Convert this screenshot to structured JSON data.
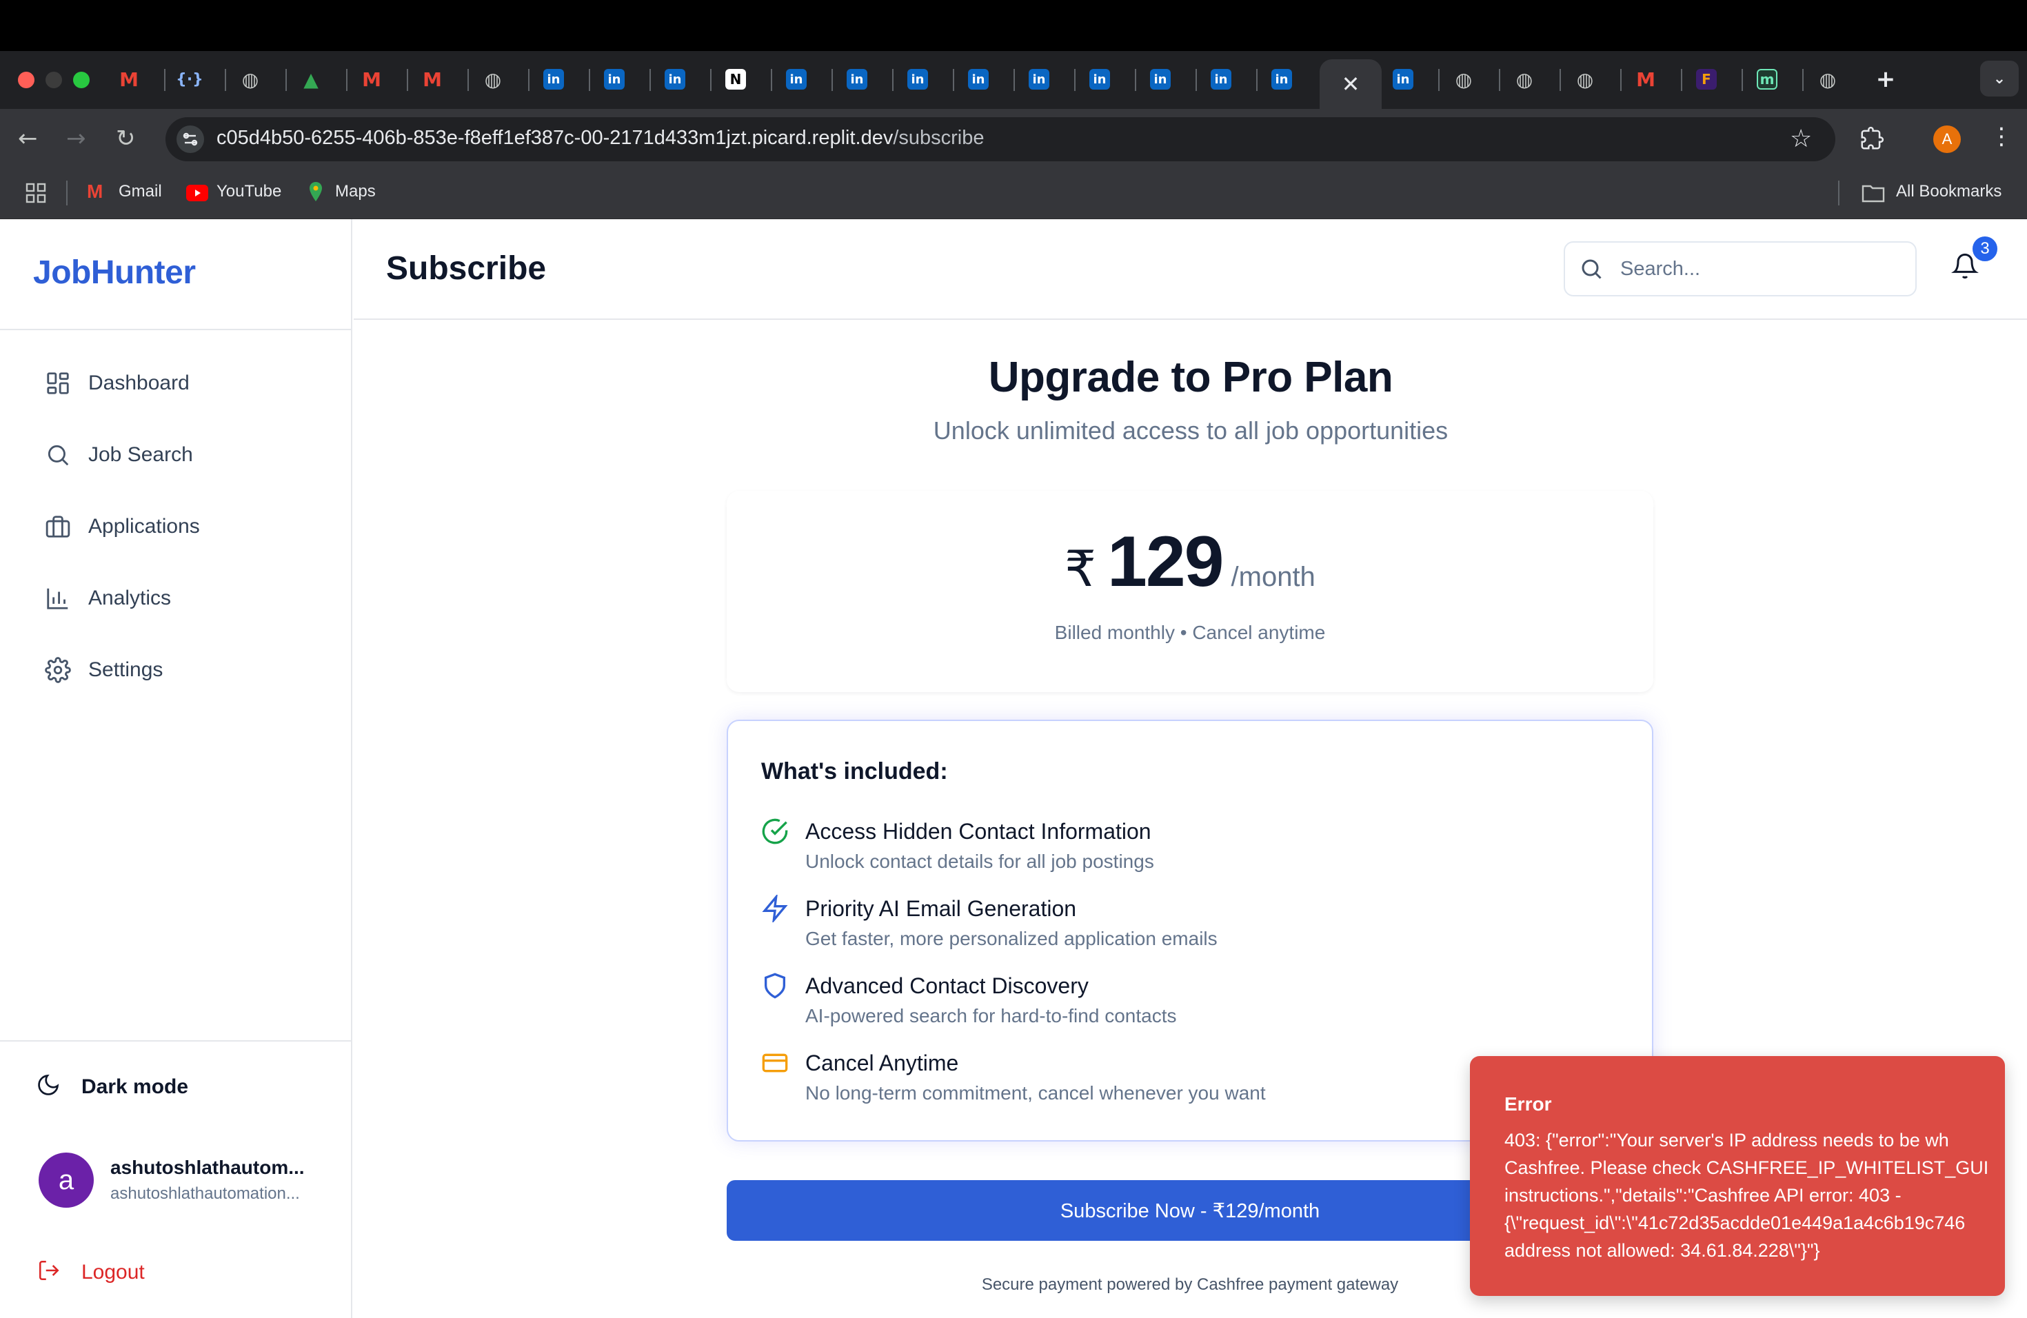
{
  "browser": {
    "url_host": "c05d4b50-6255-406b-853e-f8eff1ef387c-00-2171d433m1jzt.picard.replit.dev",
    "url_path": "/subscribe",
    "profile_initial": "A",
    "bookmarks": [
      {
        "label": "Gmail"
      },
      {
        "label": "YouTube"
      },
      {
        "label": "Maps"
      }
    ],
    "all_bookmarks_label": "All Bookmarks",
    "new_tab_glyph": "+",
    "close_glyph": "✕"
  },
  "sidebar": {
    "logo": "JobHunter",
    "nav": [
      {
        "label": "Dashboard",
        "icon": "dashboard-icon"
      },
      {
        "label": "Job Search",
        "icon": "search-icon"
      },
      {
        "label": "Applications",
        "icon": "briefcase-icon"
      },
      {
        "label": "Analytics",
        "icon": "bar-chart-icon"
      },
      {
        "label": "Settings",
        "icon": "gear-icon"
      }
    ],
    "dark_mode_label": "Dark mode",
    "user": {
      "avatar_letter": "a",
      "name": "ashutoshlathautom...",
      "email": "ashutoshlathautomation..."
    },
    "logout_label": "Logout"
  },
  "header": {
    "title": "Subscribe",
    "search_placeholder": "Search...",
    "notification_count": "3"
  },
  "main": {
    "hero_title": "Upgrade to Pro Plan",
    "hero_subtitle": "Unlock unlimited access to all job opportunities",
    "price": {
      "currency": "₹",
      "amount": "129",
      "period": "/month",
      "note": "Billed monthly • Cancel anytime"
    },
    "features_heading": "What's included:",
    "features": [
      {
        "title": "Access Hidden Contact Information",
        "desc": "Unlock contact details for all job postings",
        "icon": "check-circle-icon"
      },
      {
        "title": "Priority AI Email Generation",
        "desc": "Get faster, more personalized application emails",
        "icon": "lightning-icon"
      },
      {
        "title": "Advanced Contact Discovery",
        "desc": "AI-powered search for hard-to-find contacts",
        "icon": "shield-icon"
      },
      {
        "title": "Cancel Anytime",
        "desc": "No long-term commitment, cancel whenever you want",
        "icon": "credit-card-icon"
      }
    ],
    "subscribe_button": "Subscribe Now - ₹129/month",
    "secure_note": "Secure payment powered by Cashfree payment gateway"
  },
  "toast": {
    "title": "Error",
    "message": "403: {\"error\":\"Your server's IP address needs to be wh\nCashfree. Please check CASHFREE_IP_WHITELIST_GUI\ninstructions.\",\"details\":\"Cashfree API error: 403 -\n{\\\"request_id\\\":\\\"41c72d35acdde01e449a1a4c6b19c746\naddress not allowed: 34.61.84.228\\\"}\"}"
  },
  "colors": {
    "brand": "#2f5fd6",
    "error": "#dc4b44",
    "success": "#16a34a",
    "warning": "#f59e0b",
    "logout": "#dc2626"
  }
}
